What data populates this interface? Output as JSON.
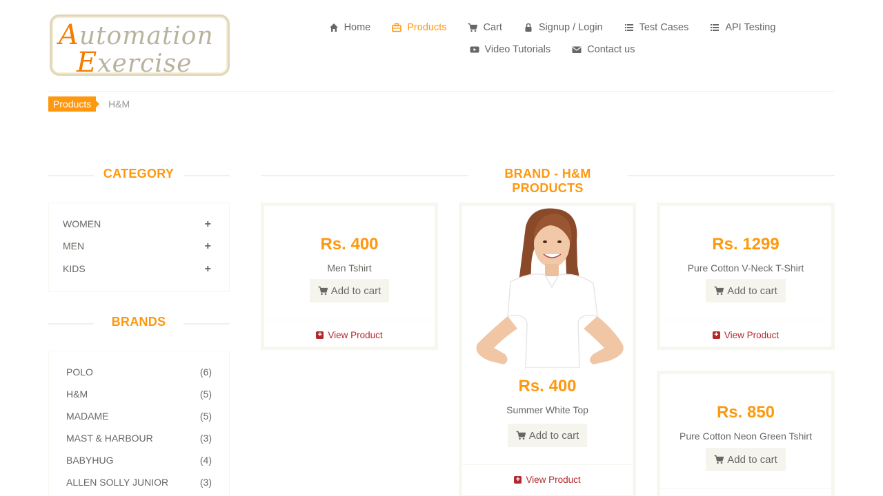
{
  "logo": {
    "line1_cap": "A",
    "line1_rest": "utomation",
    "line2_cap": "E",
    "line2_rest": "xercise"
  },
  "nav": {
    "row1": [
      {
        "label": "Home",
        "icon": "home-icon",
        "active": false
      },
      {
        "label": "Products",
        "icon": "briefcase-icon",
        "active": true
      },
      {
        "label": "Cart",
        "icon": "cart-icon",
        "active": false
      },
      {
        "label": "Signup / Login",
        "icon": "lock-icon",
        "active": false
      },
      {
        "label": "Test Cases",
        "icon": "list-icon",
        "active": false
      },
      {
        "label": "API Testing",
        "icon": "list-icon",
        "active": false
      }
    ],
    "row2": [
      {
        "label": "Video Tutorials",
        "icon": "youtube-icon",
        "active": false
      },
      {
        "label": "Contact us",
        "icon": "envelope-icon",
        "active": false
      }
    ]
  },
  "breadcrumb": {
    "parent": "Products",
    "current": "H&M"
  },
  "sidebar": {
    "category_title": "CATEGORY",
    "categories": [
      {
        "label": "WOMEN"
      },
      {
        "label": "MEN"
      },
      {
        "label": "KIDS"
      }
    ],
    "brands_title": "BRANDS",
    "brands": [
      {
        "label": "POLO",
        "count": "(6)"
      },
      {
        "label": "H&M",
        "count": "(5)"
      },
      {
        "label": "MADAME",
        "count": "(5)"
      },
      {
        "label": "MAST & HARBOUR",
        "count": "(3)"
      },
      {
        "label": "BABYHUG",
        "count": "(4)"
      },
      {
        "label": "ALLEN SOLLY JUNIOR",
        "count": "(3)"
      }
    ]
  },
  "main": {
    "title": "BRAND - H&M PRODUCTS",
    "add_to_cart_label": "Add to cart",
    "view_product_label": "View Product",
    "products": [
      {
        "price": "Rs. 400",
        "name": "Men Tshirt"
      },
      {
        "price": "Rs. 400",
        "name": "Summer White Top"
      },
      {
        "price": "Rs. 1299",
        "name": "Pure Cotton V-Neck T-Shirt"
      },
      {
        "price": "Rs. 850",
        "name": "Pure Cotton Neon Green Tshirt"
      }
    ]
  },
  "colors": {
    "accent": "#FE980F",
    "link": "#B3282D",
    "text": "#696763",
    "button_bg": "#F5F5ED"
  }
}
